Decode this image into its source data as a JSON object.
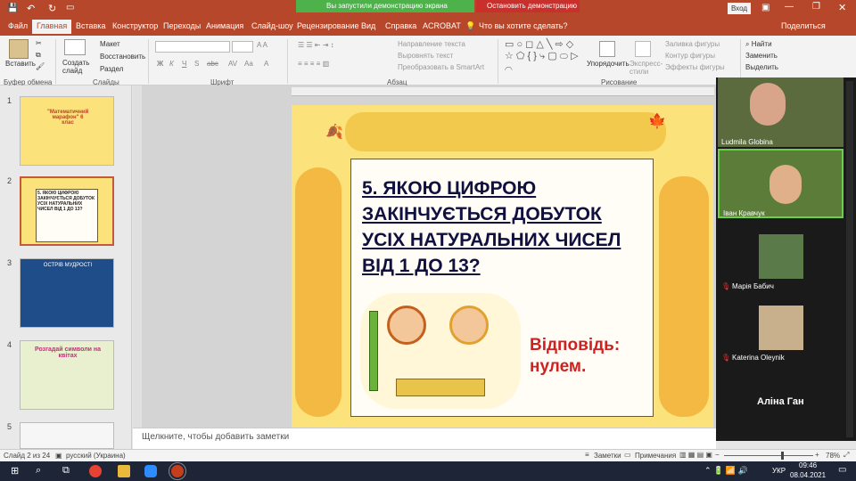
{
  "window": {
    "demo_banner": "Вы запустили демонстрацию экрана",
    "stop_demo": "Остановить демонстрацию",
    "login": "Вход"
  },
  "tabs": [
    "Файл",
    "Главная",
    "Вставка",
    "Конструктор",
    "Переходы",
    "Анимация",
    "Слайд-шоу",
    "Рецензирование",
    "Вид",
    "Справка",
    "ACROBAT"
  ],
  "tell_me": "Что вы хотите сделать?",
  "share": "Поделиться",
  "ribbon": {
    "paste": "Вставить",
    "new_slide": "Создать слайд",
    "layout": "Макет",
    "reset": "Восстановить",
    "section": "Раздел",
    "text_direction": "Направление текста",
    "align_text": "Выровнять текст",
    "smartart": "Преобразовать в SmartArt",
    "arrange": "Упорядочить",
    "quick_styles": "Экспресс-стили",
    "shape_fill": "Заливка фигуры",
    "shape_outline": "Контур фигуры",
    "shape_effects": "Эффекты фигуры",
    "find": "Найти",
    "replace": "Заменить",
    "select": "Выделить",
    "groups": {
      "clipboard": "Буфер обмена",
      "slides": "Слайды",
      "font": "Шрифт",
      "paragraph": "Абзац",
      "drawing": "Рисование"
    }
  },
  "thumbnails": [
    {
      "num": "1",
      "text": "\"Математичний марафон\" 6 клас"
    },
    {
      "num": "2",
      "text": "5. ЯКОЮ ЦИФРОЮ ЗАКІНЧУЄТЬСЯ ДОБУТОК УСІХ НАТУРАЛЬНИХ ЧИСЕЛ ВІД 1 ДО 13?"
    },
    {
      "num": "3",
      "text": "ОСТРІВ МУДРОСТІ"
    },
    {
      "num": "4",
      "text": "Розгадай символи на квітах"
    },
    {
      "num": "5",
      "text": ""
    }
  ],
  "slide": {
    "question": "5. ЯКОЮ ЦИФРОЮ ЗАКІНЧУЄТЬСЯ ДОБУТОК УСІХ НАТУРАЛЬНИХ ЧИСЕЛ ВІД 1 ДО 13?",
    "answer_label": "Відповідь:",
    "answer_value": "нулем."
  },
  "notes_placeholder": "Щелкните, чтобы добавить заметки",
  "participants": [
    {
      "name": "Ludmila Globina"
    },
    {
      "name": "Іван Кравчук"
    },
    {
      "name": "Марія Бабич"
    },
    {
      "name": "Katerina Oleynik"
    },
    {
      "name": "Аліна Ган"
    }
  ],
  "status": {
    "slide_info": "Слайд 2 из 24",
    "language": "русский (Украина)",
    "notes": "Заметки",
    "comments": "Примечания",
    "zoom": "78%"
  },
  "taskbar": {
    "lang": "УКР",
    "time": "09:46",
    "date": "08.04.2021"
  }
}
